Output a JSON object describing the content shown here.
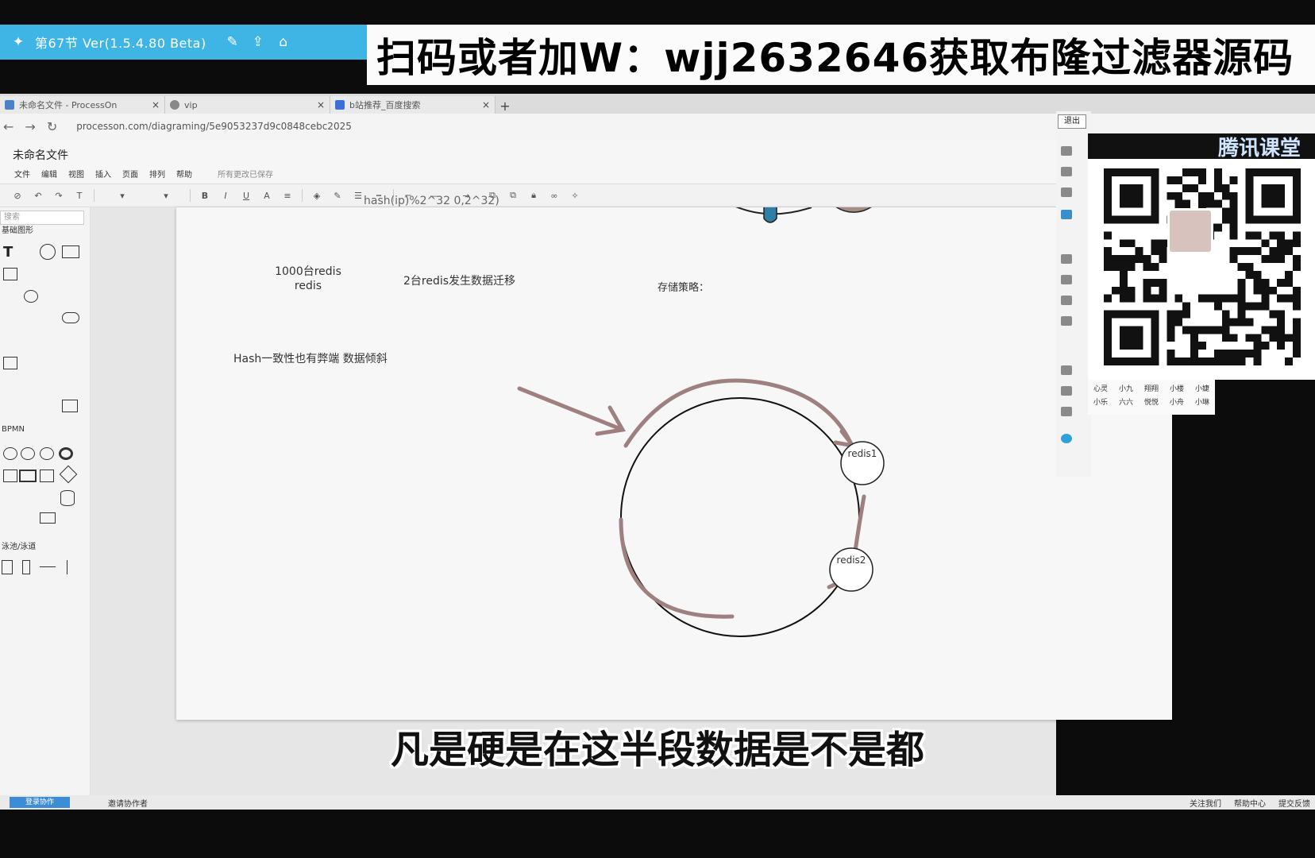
{
  "player": {
    "lesson": "第67节",
    "version": "Ver(1.5.4.80 Beta)"
  },
  "promo": {
    "text": "扫码或者加W：wjj2632646获取布隆过滤器源码"
  },
  "browser": {
    "tabs": [
      {
        "label": "未命名文件 - ProcessOn"
      },
      {
        "label": "vip"
      },
      {
        "label": "b站推荐_百度搜索"
      }
    ],
    "url": "processon.com/diagraming/5e9053237d9c0848cebc2025"
  },
  "app": {
    "title": "未命名文件",
    "menu": [
      "文件",
      "编辑",
      "视图",
      "插入",
      "页面",
      "排列",
      "帮助"
    ],
    "saved_status": "所有更改已保存",
    "search_placeholder": "搜索",
    "sections": {
      "basic": "基础图形",
      "bpmn": "BPMN",
      "lane": "泳池/泳道"
    }
  },
  "canvas": {
    "formula": "hash(ip)%2^32  0,2^32)",
    "note_1000": "1000台redis",
    "note_redis": "redis",
    "note_migration": "2台redis发生数据迁移",
    "note_strategy": "存储策略：",
    "note_skew": "Hash一致性也有弊端  数据倾斜",
    "node1": "redis1",
    "node2": "redis2"
  },
  "right_panel": {
    "exit": "退出",
    "brand": "腾讯课堂",
    "contacts_row1": [
      "心灵",
      "小九",
      "翔翔",
      "小楼",
      "小婕"
    ],
    "contacts_row2": [
      "小乐",
      "六六",
      "悦悦",
      "小舟",
      "小琳"
    ]
  },
  "status": {
    "left_button": "登录协作",
    "invite": "邀请协作者",
    "right": [
      "关注我们",
      "帮助中心",
      "提交反馈"
    ]
  },
  "subtitle": "凡是硬是在这半段数据是不是都",
  "colors": {
    "player_bar": "#3fb5e6",
    "ring": "#9e8080",
    "node_fill": "#ffffff"
  }
}
